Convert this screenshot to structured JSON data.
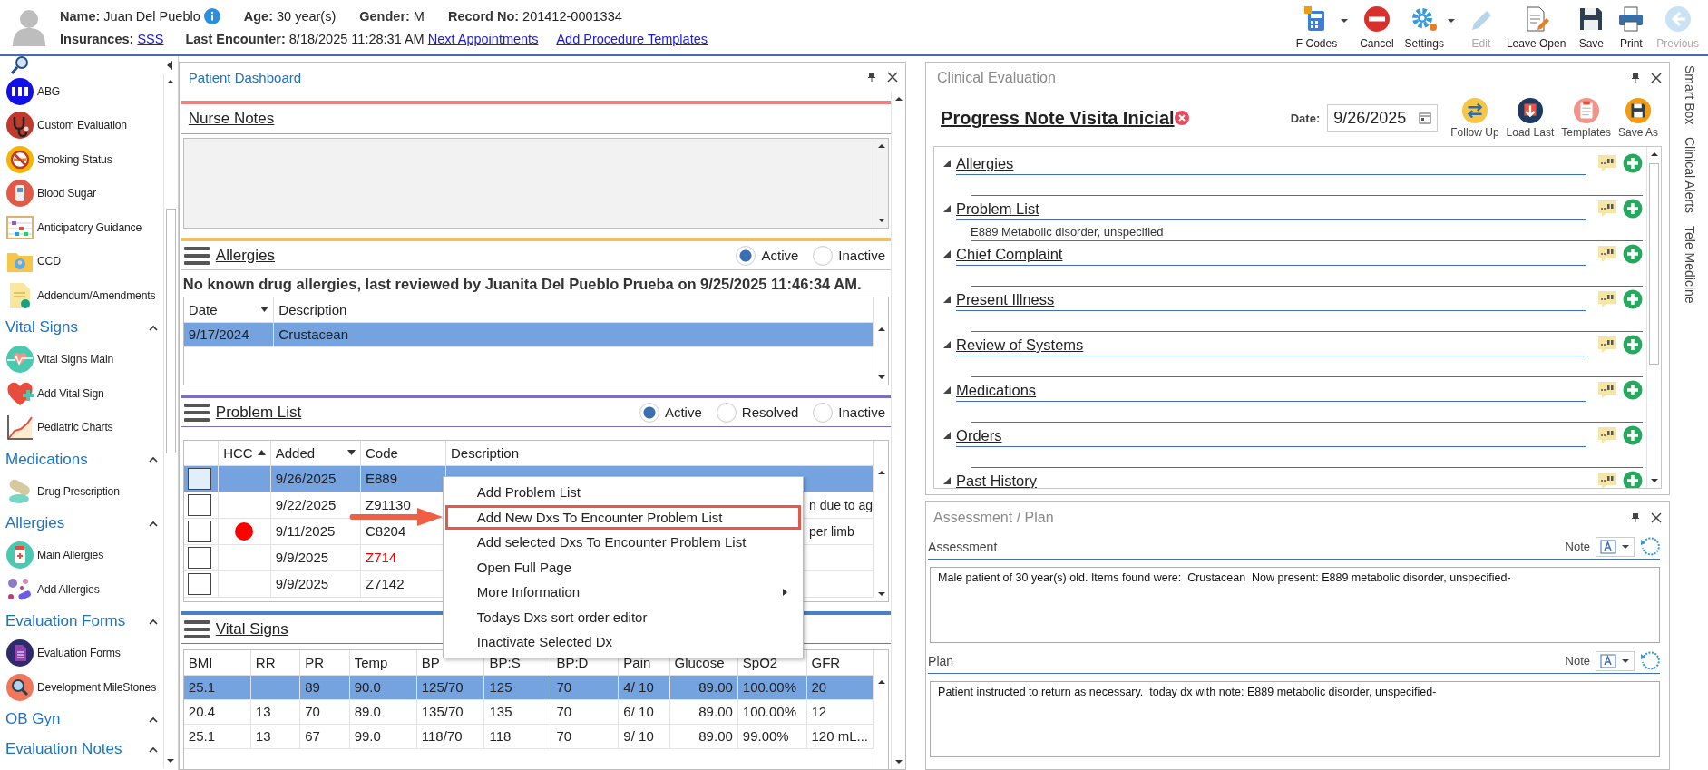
{
  "patient": {
    "fields": [
      {
        "label": "Name:",
        "value": "Juan Del Pueblo",
        "info": true
      },
      {
        "label": "Age:",
        "value": "30 year(s)",
        "info": false
      },
      {
        "label": "Gender:",
        "value": "M",
        "info": false
      },
      {
        "label": "Record No:",
        "value": "201412-0001334",
        "info": false
      }
    ],
    "encounter": [
      {
        "label": "Insurances:",
        "value": "SSS",
        "link": true
      },
      {
        "label": "Last Encounter:",
        "value": "8/18/2025 11:28:31 AM",
        "link": false
      }
    ],
    "links": [
      "Next Appointments",
      "Add Procedure Templates"
    ]
  },
  "toolbar": [
    {
      "label": "F Codes",
      "dropdown": true,
      "disabled": false
    },
    {
      "label": "Cancel",
      "dropdown": false,
      "disabled": false
    },
    {
      "label": "Settings",
      "dropdown": true,
      "disabled": false
    },
    {
      "label": "Edit",
      "dropdown": false,
      "disabled": true
    },
    {
      "label": "Leave Open",
      "dropdown": false,
      "disabled": false
    },
    {
      "label": "Save",
      "dropdown": false,
      "disabled": false
    },
    {
      "label": "Print",
      "dropdown": false,
      "disabled": false
    },
    {
      "label": "Previous",
      "dropdown": false,
      "disabled": true
    }
  ],
  "sidebar": {
    "groups": [
      {
        "items": [
          "ABG",
          "Custom Evaluation",
          "Smoking Status",
          "Blood Sugar",
          "Anticipatory Guidance",
          "CCD",
          "Addendum/Amendments"
        ]
      },
      {
        "title": "Vital Signs",
        "expanded": true,
        "items": [
          "Vital Signs Main",
          "Add Vital Sign",
          "Pediatric Charts"
        ]
      },
      {
        "title": "Medications",
        "expanded": true,
        "items": [
          "Drug Prescription"
        ]
      },
      {
        "title": "Allergies",
        "expanded": true,
        "items": [
          "Main Allergies",
          "Add Allergies"
        ]
      },
      {
        "title": "Evaluation Forms",
        "expanded": true,
        "items": [
          "Evaluation Forms",
          "Development MileStones"
        ]
      },
      {
        "title": "OB Gyn",
        "expanded": true
      },
      {
        "title": "Evaluation Notes",
        "expanded": true
      }
    ]
  },
  "dashboard": {
    "title": "Patient Dashboard",
    "nurse_notes": {
      "title": "Nurse Notes"
    },
    "allergies": {
      "title": "Allergies",
      "filters": [
        {
          "label": "Active",
          "selected": true
        },
        {
          "label": "Inactive",
          "selected": false
        }
      ],
      "summary": "No known drug allergies, last reviewed by Juanita Del Pueblo Prueba on 9/25/2025 11:46:34 AM.",
      "columns": [
        {
          "label": "Date",
          "sort_up": false,
          "sort_down": true
        },
        {
          "label": "Description",
          "sort_up": false,
          "sort_down": false
        }
      ],
      "rows": [
        {
          "cells": [
            "9/17/2024",
            "Crustacean"
          ],
          "selected": true
        }
      ]
    },
    "problem_list": {
      "title": "Problem List",
      "filters": [
        {
          "label": "Active",
          "selected": true
        },
        {
          "label": "Resolved",
          "selected": false
        },
        {
          "label": "Inactive",
          "selected": false
        }
      ],
      "columns": [
        {
          "label": "HCC",
          "sort_up": true,
          "sort_down": false
        },
        {
          "label": "Added",
          "sort_up": false,
          "sort_down": true
        },
        {
          "label": "Code",
          "sort_up": false,
          "sort_down": false
        },
        {
          "label": "Description",
          "sort_up": false,
          "sort_down": false
        }
      ],
      "rows": [
        {
          "checked": false,
          "hcc": false,
          "added": "9/26/2025",
          "code": "E889",
          "flagged": false,
          "selected": true
        },
        {
          "checked": false,
          "hcc": false,
          "added": "9/22/2025",
          "code": "Z91130",
          "flagged": false,
          "description": "n due to ag",
          "selected": false
        },
        {
          "checked": false,
          "hcc": true,
          "added": "9/11/2025",
          "code": "C8204",
          "flagged": false,
          "description": "per limb",
          "selected": false
        },
        {
          "checked": false,
          "hcc": false,
          "added": "9/9/2025",
          "code": "Z714",
          "flagged": true,
          "selected": false
        },
        {
          "checked": false,
          "hcc": false,
          "added": "9/9/2025",
          "code": "Z7142",
          "flagged": false,
          "selected": false
        }
      ]
    },
    "vital_signs": {
      "title": "Vital Signs",
      "columns": [
        "BMI",
        "RR",
        "PR",
        "Temp",
        "BP",
        "BP:S",
        "BP:D",
        "Pain",
        "Glucose",
        "SpO2",
        "GFR"
      ],
      "rows": [
        {
          "cells": [
            "25.1",
            null,
            "89",
            "90.0",
            "125/70",
            "125",
            "70",
            "4/ 10",
            "89.00",
            "100.00%",
            "20"
          ],
          "selected": true
        },
        {
          "cells": [
            "20.4",
            "13",
            "70",
            "89.0",
            "135/70",
            "135",
            "70",
            "6/ 10",
            "89.00",
            "100.00%",
            "12"
          ],
          "selected": false
        },
        {
          "cells": [
            "25.1",
            "13",
            "67",
            "99.0",
            "118/70",
            "118",
            "70",
            "9/ 10",
            "89.00",
            "99.00%",
            "120 mL..."
          ],
          "selected": false
        }
      ]
    }
  },
  "context_menu": {
    "items": [
      {
        "label": "Add Problem List",
        "highlighted": false,
        "submenu": false
      },
      {
        "label": "Add New Dxs To Encounter Problem List",
        "highlighted": true,
        "submenu": false
      },
      {
        "label": "Add selected Dxs To Encounter Problem List",
        "highlighted": false,
        "submenu": false
      },
      {
        "label": "Open Full Page",
        "highlighted": false,
        "submenu": false
      },
      {
        "label": "More Information",
        "highlighted": false,
        "submenu": true
      },
      {
        "label": "Todays Dxs sort order editor",
        "highlighted": false,
        "submenu": false
      },
      {
        "label": "Inactivate Selected Dx",
        "highlighted": false,
        "submenu": false
      }
    ]
  },
  "clinical_evaluation": {
    "title": "Clinical Evaluation",
    "note_title": "Progress Note Visita Inicial",
    "date_label": "Date:",
    "date": "9/26/2025",
    "actions": [
      "Follow Up",
      "Load Last",
      "Templates",
      "Save As"
    ],
    "sections": [
      {
        "title": "Allergies",
        "expanded": true
      },
      {
        "title": "Problem List",
        "expanded": true,
        "content": "E889 Metabolic disorder, unspecified"
      },
      {
        "title": "Chief Complaint",
        "expanded": true
      },
      {
        "title": "Present Illness",
        "expanded": true
      },
      {
        "title": "Review of Systems",
        "expanded": true
      },
      {
        "title": "Medications",
        "expanded": true
      },
      {
        "title": "Orders",
        "expanded": true
      },
      {
        "title": "Past History",
        "expanded": true
      }
    ]
  },
  "assessment_plan": {
    "title": "Assessment / Plan",
    "notes": [
      {
        "label": "Assessment",
        "note_label": "Note",
        "text": "Male patient of 30 year(s) old. Items found were:  Crustacean  Now present: E889 metabolic disorder, unspecified-"
      },
      {
        "label": "Plan",
        "note_label": "Note",
        "text": "Patient instructed to return as necessary.  today dx with note: E889 metabolic disorder, unspecified-"
      }
    ]
  },
  "side_tabs": [
    "Smart Box",
    "Clinical Alerts",
    "Tele Medicine"
  ]
}
